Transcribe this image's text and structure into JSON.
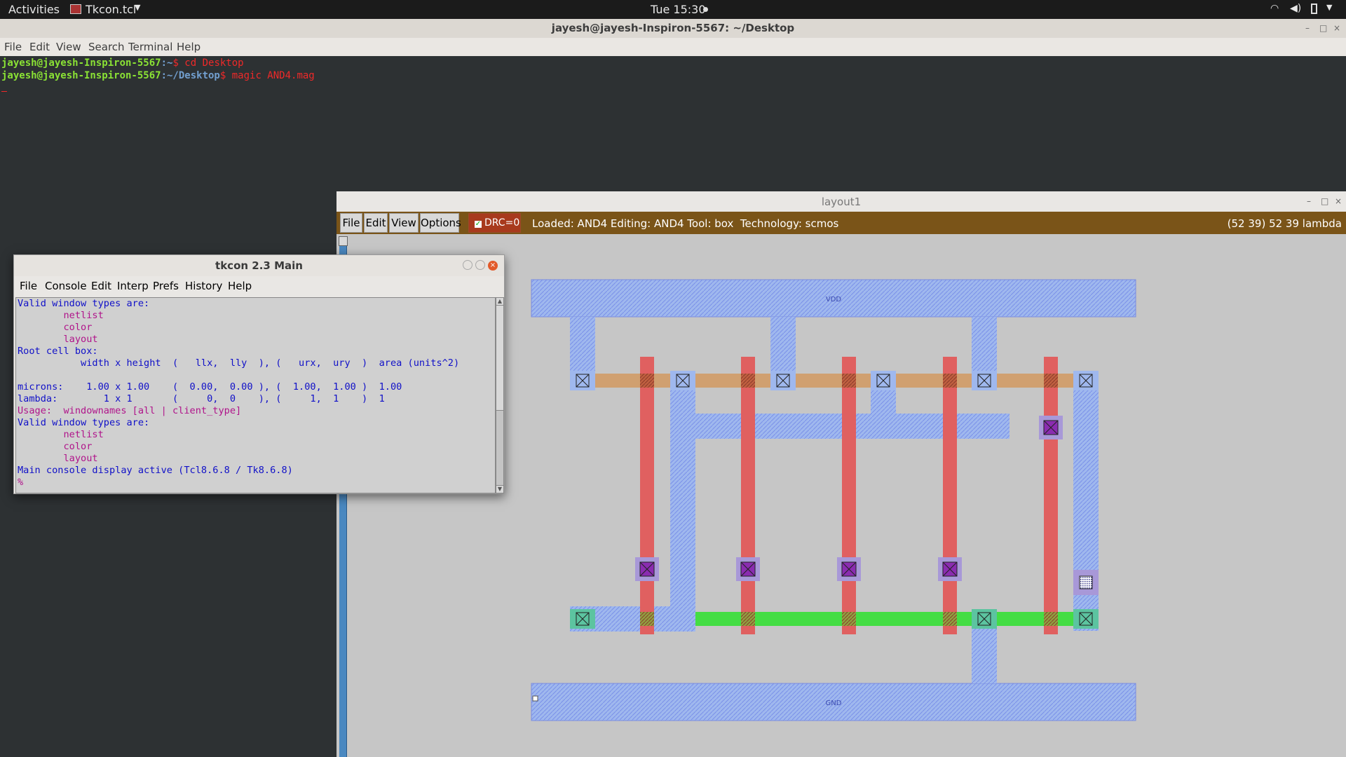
{
  "topbar": {
    "activities": "Activities",
    "app_menu": "Tkcon.tcl",
    "clock": "Tue 15:30"
  },
  "terminal": {
    "title": "jayesh@jayesh-Inspiron-5567: ~/Desktop",
    "menu": [
      "File",
      "Edit",
      "View",
      "Search",
      "Terminal",
      "Help"
    ],
    "lines": [
      {
        "user": "jayesh@jayesh-Inspiron-5567",
        "path": ":~",
        "cmd": "$ cd Desktop"
      },
      {
        "user": "jayesh@jayesh-Inspiron-5567",
        "path": ":~/Desktop",
        "cmd": "$ magic AND4.mag"
      }
    ]
  },
  "layout_window": {
    "title": "layout1",
    "menu": [
      "File",
      "Edit",
      "View",
      "Options"
    ],
    "drc": "DRC=0",
    "status": "Loaded: AND4 Editing: AND4 Tool: box  Technology: scmos",
    "coords": "(52 39) 52 39 lambda",
    "vdd_label": "VDD",
    "gnd_label": "GND",
    "colors": {
      "background": "#c6c6c6",
      "metal1": "#9fb8ee",
      "poly": "#e06060",
      "pdiff": "#d0a070",
      "ndiff": "#44dd44",
      "contact": "#8a2cb0"
    }
  },
  "tkcon": {
    "title": "tkcon 2.3 Main",
    "menu": [
      "File",
      "Console",
      "Edit",
      "Interp",
      "Prefs",
      "History",
      "Help"
    ],
    "lines": [
      {
        "text": "Valid window types are:",
        "color": "blue"
      },
      {
        "text": "        netlist",
        "color": "magenta"
      },
      {
        "text": "        color",
        "color": "magenta"
      },
      {
        "text": "        layout",
        "color": "magenta"
      },
      {
        "text": "Root cell box:",
        "color": "blue"
      },
      {
        "text": "           width x height  (   llx,  lly  ), (   urx,  ury  )  area (units^2)",
        "color": "blue"
      },
      {
        "text": "",
        "color": "blue"
      },
      {
        "text": "microns:    1.00 x 1.00    (  0.00,  0.00 ), (  1.00,  1.00 )  1.00",
        "color": "blue"
      },
      {
        "text": "lambda:        1 x 1       (     0,  0    ), (     1,  1    )  1",
        "color": "blue"
      },
      {
        "text": "Usage:  windownames [all | client_type]",
        "color": "magenta"
      },
      {
        "text": "Valid window types are:",
        "color": "blue"
      },
      {
        "text": "        netlist",
        "color": "magenta"
      },
      {
        "text": "        color",
        "color": "magenta"
      },
      {
        "text": "        layout",
        "color": "magenta"
      },
      {
        "text": "Main console display active (Tcl8.6.8 / Tk8.6.8)",
        "color": "blue"
      },
      {
        "text": "%",
        "color": "magenta"
      }
    ]
  }
}
